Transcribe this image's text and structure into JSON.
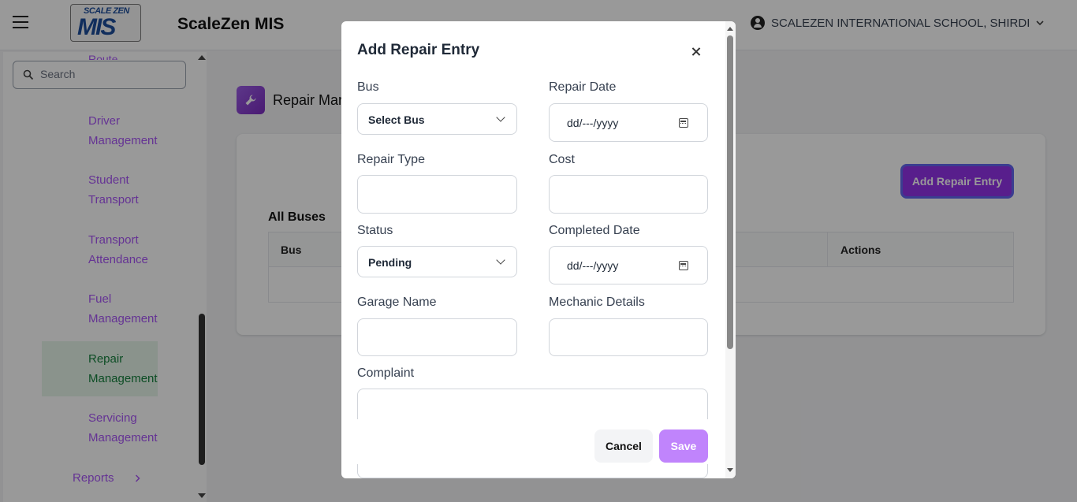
{
  "header": {
    "logo_top": "SCALE ZEN",
    "logo_main": "MIS",
    "app_title": "ScaleZen MIS",
    "school": "SCALEZEN INTERNATIONAL SCHOOL, SHIRDI"
  },
  "sidebar": {
    "search_placeholder": "Search",
    "routes_fragment": "Route",
    "items": [
      {
        "line1": "Driver",
        "line2": "Management"
      },
      {
        "line1": "Student",
        "line2": "Transport"
      },
      {
        "line1": "Transport",
        "line2": "Attendance"
      },
      {
        "line1": "Fuel",
        "line2": "Management"
      },
      {
        "line1": "Repair",
        "line2": "Management",
        "active": true
      },
      {
        "line1": "Servicing",
        "line2": "Management"
      }
    ],
    "reports": "Reports"
  },
  "page": {
    "title": "Repair Mar",
    "add_button": "Add Repair Entry",
    "all_buses": "All Buses",
    "table_headers": [
      "Bus",
      "Actions"
    ]
  },
  "modal": {
    "title": "Add Repair Entry",
    "bus_label": "Bus",
    "bus_value": "Select Bus",
    "repair_date_label": "Repair Date",
    "repair_date_value": "dd/---/yyyy",
    "repair_type_label": "Repair Type",
    "cost_label": "Cost",
    "status_label": "Status",
    "status_value": "Pending",
    "completed_date_label": "Completed Date",
    "completed_date_value": "dd/---/yyyy",
    "garage_label": "Garage Name",
    "mechanic_label": "Mechanic Details",
    "complaint_label": "Complaint",
    "cancel": "Cancel",
    "save": "Save"
  },
  "colors": {
    "accent": "#a855f7",
    "primary_button": "#9333ea",
    "save_button": "#c084fc",
    "active_nav_bg": "#e6f5ea",
    "active_nav_text": "#15803d"
  }
}
